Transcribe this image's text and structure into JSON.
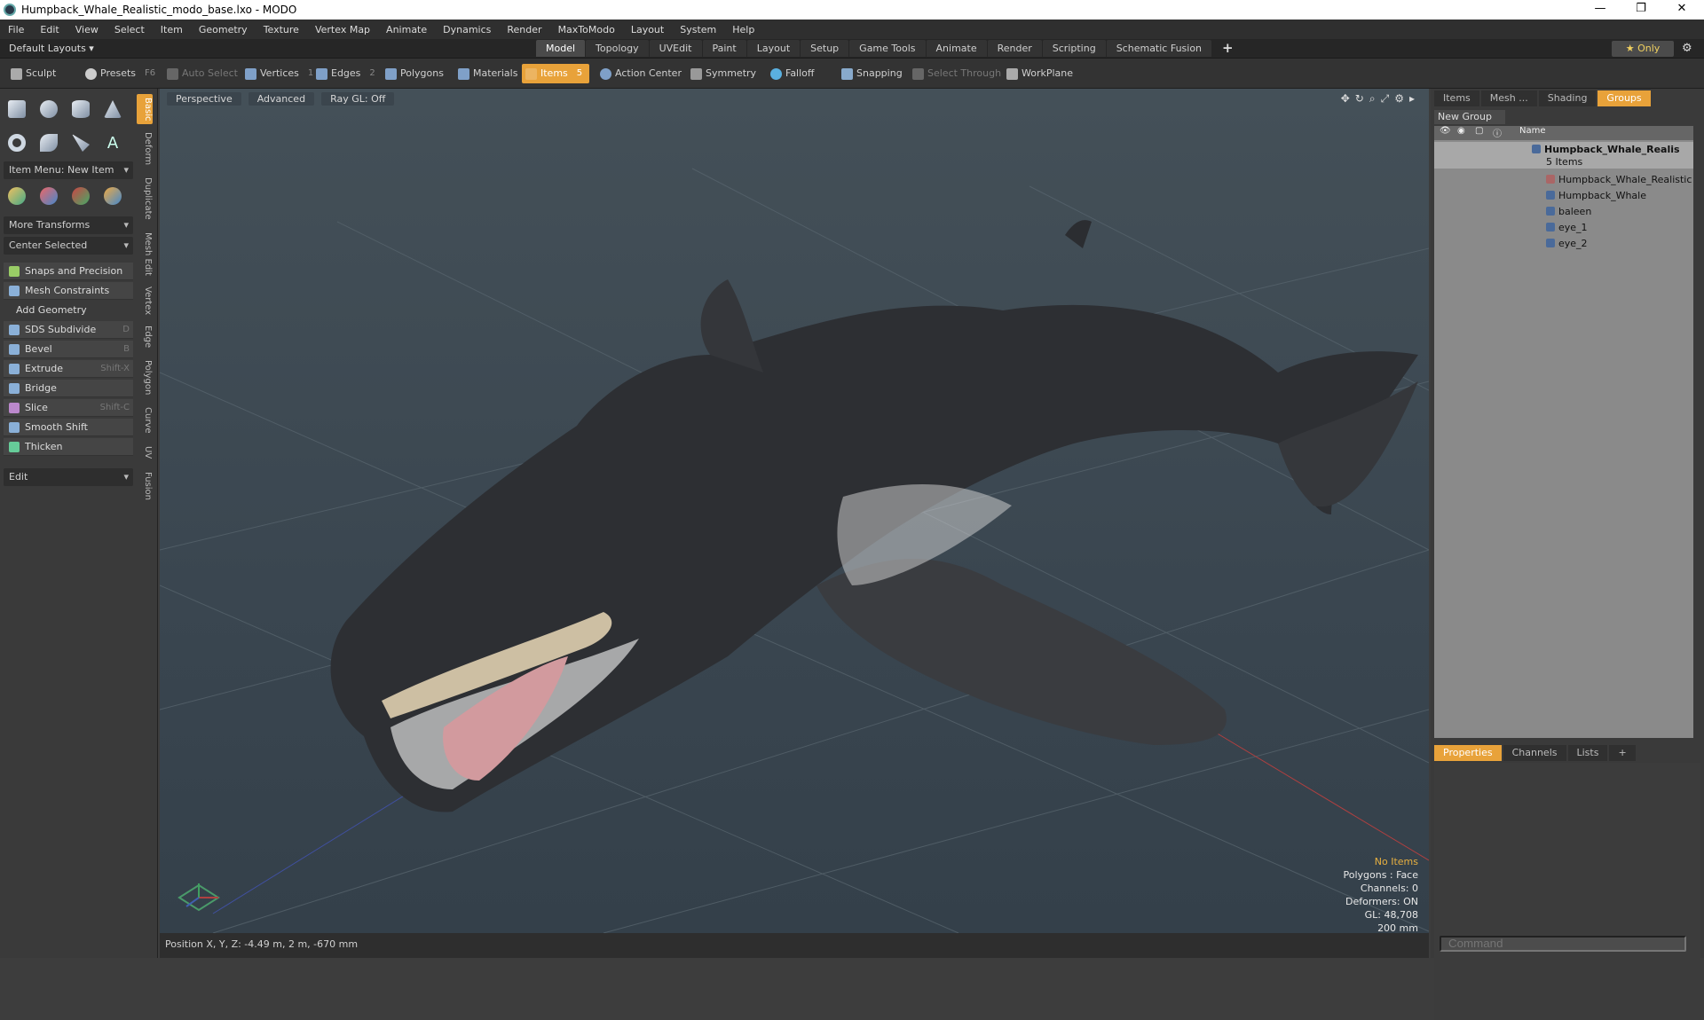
{
  "title": "Humpback_Whale_Realistic_modo_base.lxo - MODO",
  "window_controls": {
    "minimize": "—",
    "restore": "❐",
    "close": "✕"
  },
  "menu": [
    "File",
    "Edit",
    "View",
    "Select",
    "Item",
    "Geometry",
    "Texture",
    "Vertex Map",
    "Animate",
    "Dynamics",
    "Render",
    "MaxToModo",
    "Layout",
    "System",
    "Help"
  ],
  "layout_bar": {
    "default_layouts": "Default Layouts ▾",
    "tabs": [
      "Model",
      "Topology",
      "UVEdit",
      "Paint",
      "Layout",
      "Setup",
      "Game Tools",
      "Animate",
      "Render",
      "Scripting",
      "Schematic Fusion"
    ],
    "active_tab": "Model",
    "plus": "+",
    "only": "★  Only",
    "gear": "⚙"
  },
  "toolbar": {
    "sculpt": "Sculpt",
    "presets": "Presets",
    "presets_key": "F6",
    "auto_select": "Auto Select",
    "vertices": "Vertices",
    "vertices_n": "1",
    "edges": "Edges",
    "edges_n": "2",
    "polygons": "Polygons",
    "materials": "Materials",
    "items": "Items",
    "items_n": "5",
    "action_center": "Action Center",
    "symmetry": "Symmetry",
    "falloff": "Falloff",
    "snapping": "Snapping",
    "select_through": "Select Through",
    "workplane": "WorkPlane"
  },
  "left": {
    "item_menu": "Item Menu: New Item",
    "more_transforms": "More Transforms",
    "center_selected": "Center Selected",
    "snaps": "Snaps and Precision",
    "mesh_constraints": "Mesh Constraints",
    "add_geometry": "Add Geometry",
    "tools": [
      {
        "label": "SDS Subdivide",
        "key": "D"
      },
      {
        "label": "Bevel",
        "key": "B"
      },
      {
        "label": "Extrude",
        "key": "Shift-X"
      },
      {
        "label": "Bridge",
        "key": ""
      },
      {
        "label": "Slice",
        "key": "Shift-C"
      },
      {
        "label": "Smooth Shift",
        "key": ""
      },
      {
        "label": "Thicken",
        "key": ""
      }
    ],
    "edit": "Edit",
    "vtabs": [
      "Basic",
      "Deform",
      "Duplicate",
      "Mesh Edit",
      "Vertex",
      "Edge",
      "Polygon",
      "Curve",
      "UV",
      "Fusion"
    ]
  },
  "viewport": {
    "perspective": "Perspective",
    "advanced": "Advanced",
    "raygl": "Ray GL: Off",
    "hud": {
      "no_items": "No Items",
      "polygons": "Polygons : Face",
      "channels": "Channels: 0",
      "deformers": "Deformers: ON",
      "gl": "GL: 48,708",
      "scale": "200 mm"
    }
  },
  "status": {
    "position": "Position X, Y, Z:   -4.49 m, 2 m, -670 mm"
  },
  "right": {
    "tabs": [
      "Items",
      "Mesh ...",
      "Shading",
      "Groups"
    ],
    "active_tab": "Groups",
    "new_group": "New Group",
    "name_header": "Name",
    "group_name": "Humpback_Whale_Realis ...",
    "group_count": "5 Items",
    "children": [
      "Humpback_Whale_Realistic",
      "Humpback_Whale",
      "baleen",
      "eye_1",
      "eye_2"
    ],
    "props_tabs": [
      "Properties",
      "Channels",
      "Lists",
      "+"
    ],
    "command": "Command"
  }
}
